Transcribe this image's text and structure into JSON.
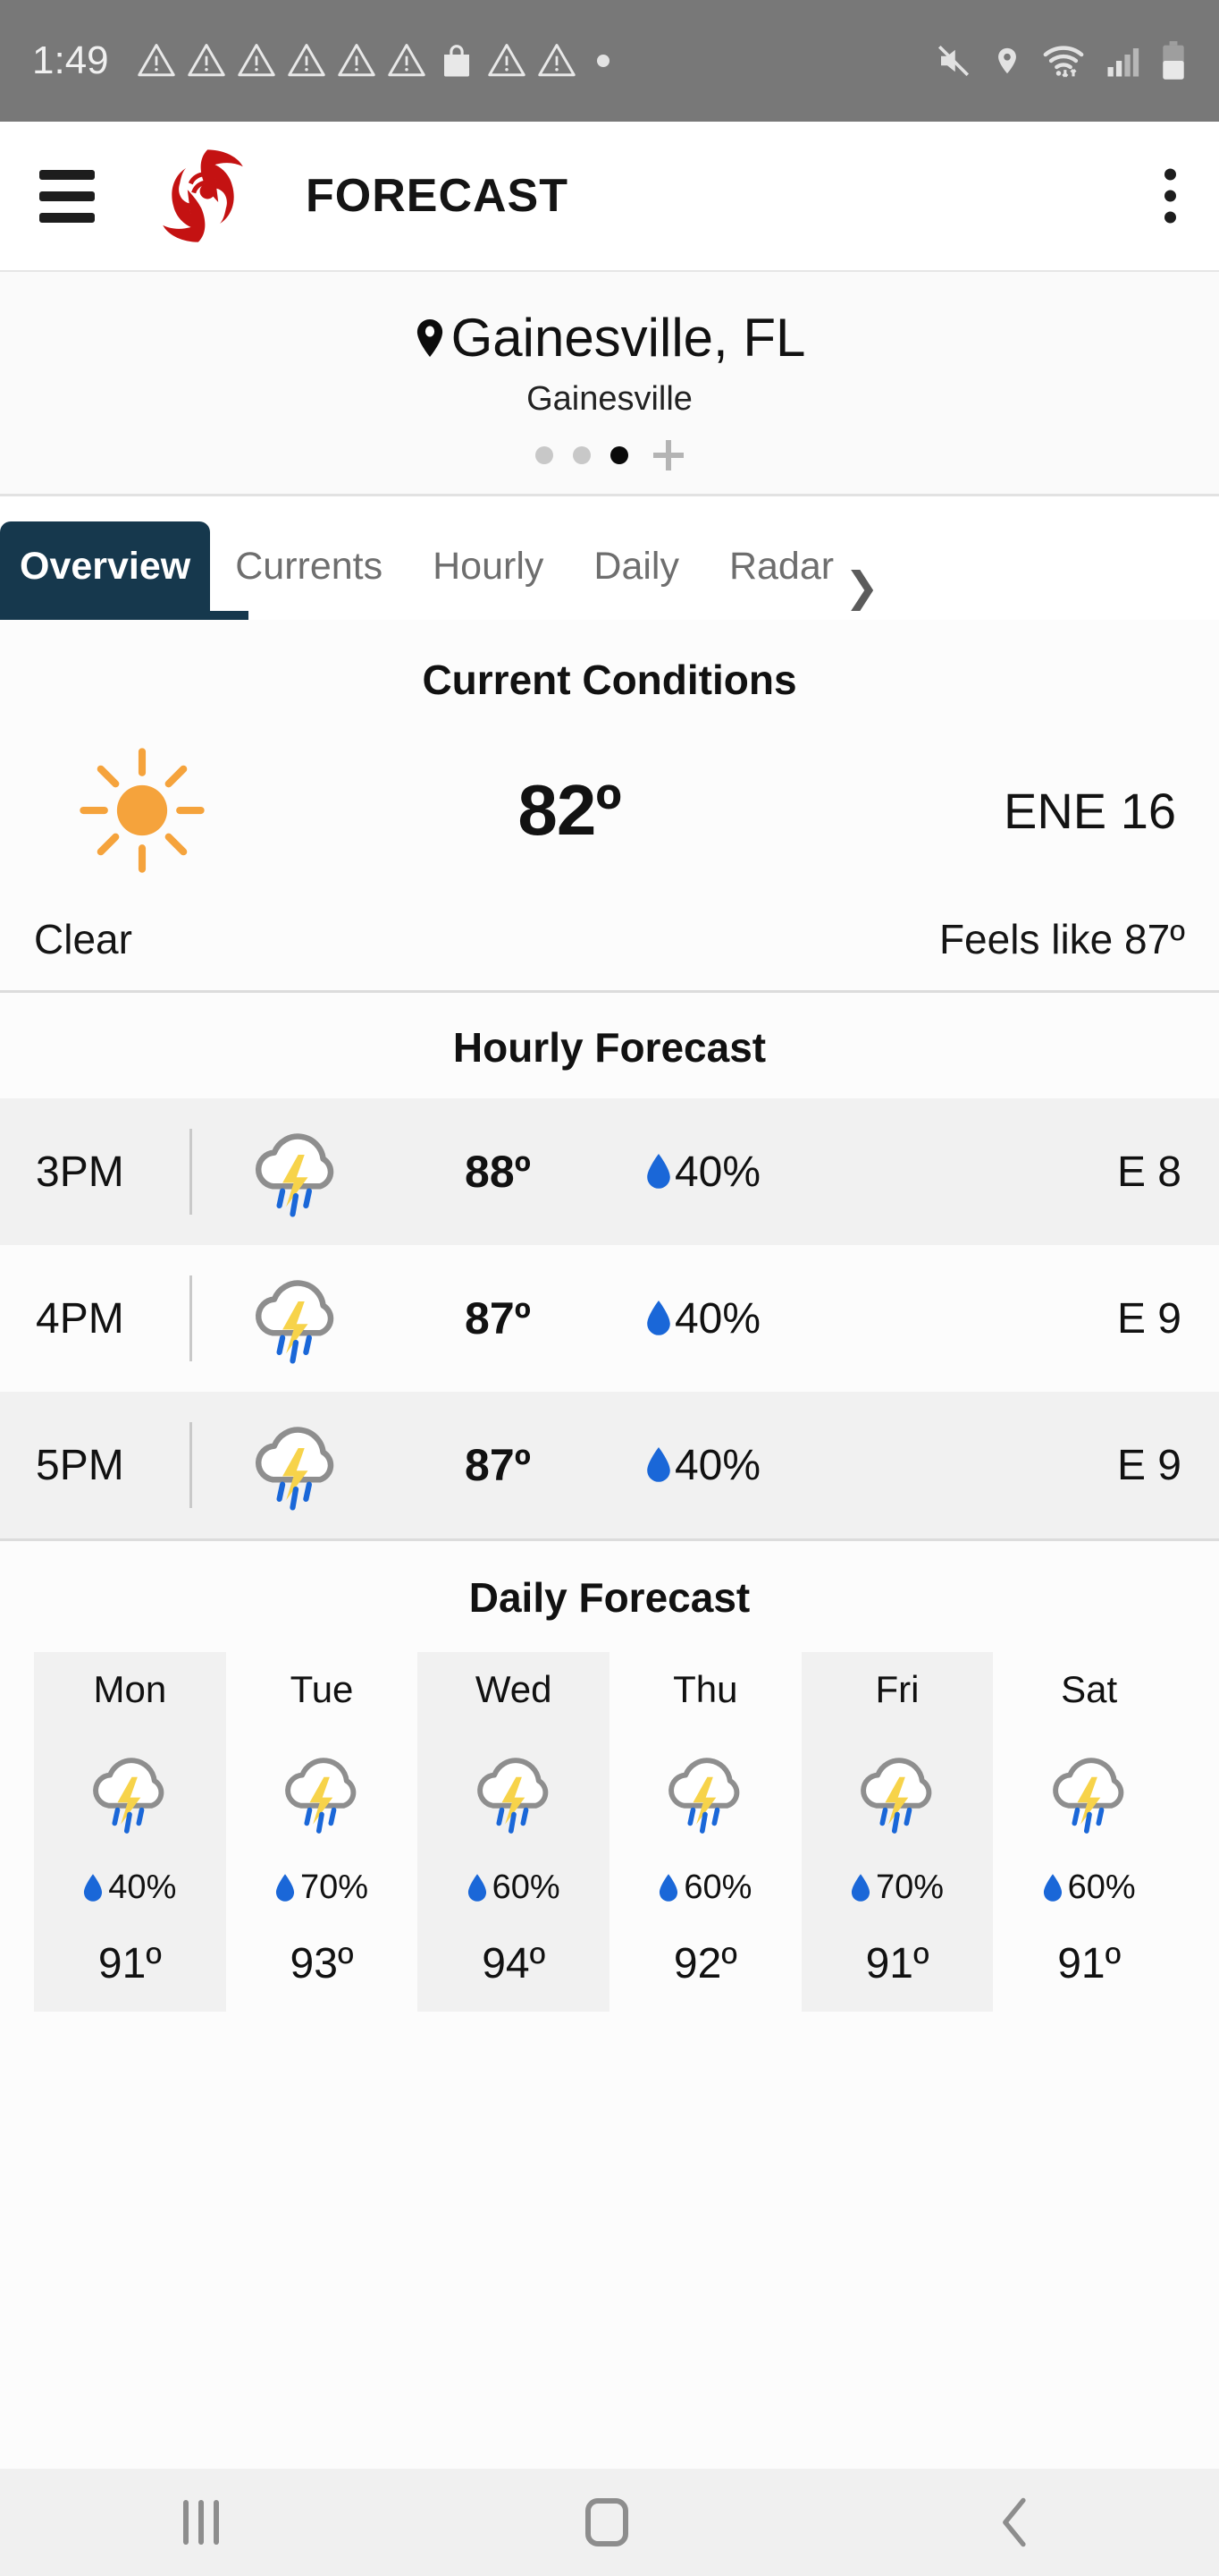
{
  "status_bar": {
    "time": "1:49",
    "left_icons": [
      "warning-icon",
      "warning-icon",
      "warning-icon",
      "warning-icon",
      "warning-icon",
      "warning-icon",
      "shopping-bag-icon",
      "warning-icon",
      "warning-icon",
      "dot-icon"
    ],
    "right_icons": [
      "mute-icon",
      "location-icon",
      "wifi-icon",
      "signal-icon",
      "battery-icon"
    ],
    "bar_color": "#787878"
  },
  "app_bar": {
    "menu_icon": "hamburger-menu-icon",
    "logo_icon": "hurricane-logo-icon",
    "logo_color": "#C41212",
    "title": "FORECAST",
    "overflow_icon": "kebab-menu-icon"
  },
  "location": {
    "pin_icon": "map-pin-icon",
    "name": "Gainesville, FL",
    "sub_name": "Gainesville",
    "pager": {
      "count": 3,
      "active_index": 2,
      "add_label": "+"
    }
  },
  "tabs": {
    "items": [
      {
        "label": "Overview",
        "active": true
      },
      {
        "label": "Currents",
        "active": false
      },
      {
        "label": "Hourly",
        "active": false
      },
      {
        "label": "Daily",
        "active": false
      },
      {
        "label": "Radar",
        "active": false
      }
    ],
    "more_icon": "chevron-right-icon",
    "active_color": "#16384D"
  },
  "current_conditions": {
    "title": "Current Conditions",
    "icon": "sun-clear-icon",
    "icon_color": "#F5A33C",
    "temperature": "82º",
    "wind": "ENE  16",
    "condition": "Clear",
    "feels_like": "Feels like 87º"
  },
  "hourly_forecast": {
    "title": "Hourly Forecast",
    "rows": [
      {
        "time": "3PM",
        "icon": "thunderstorm-icon",
        "temp": "88º",
        "pop": "40%",
        "wind": "E  8"
      },
      {
        "time": "4PM",
        "icon": "thunderstorm-icon",
        "temp": "87º",
        "pop": "40%",
        "wind": "E  9"
      },
      {
        "time": "5PM",
        "icon": "thunderstorm-icon",
        "temp": "87º",
        "pop": "40%",
        "wind": "E  9"
      }
    ]
  },
  "daily_forecast": {
    "title": "Daily Forecast",
    "days": [
      {
        "day": "Mon",
        "icon": "thunderstorm-icon",
        "pop": "40%",
        "temp": "91º"
      },
      {
        "day": "Tue",
        "icon": "thunderstorm-icon",
        "pop": "70%",
        "temp": "93º"
      },
      {
        "day": "Wed",
        "icon": "thunderstorm-icon",
        "pop": "60%",
        "temp": "94º"
      },
      {
        "day": "Thu",
        "icon": "thunderstorm-icon",
        "pop": "60%",
        "temp": "92º"
      },
      {
        "day": "Fri",
        "icon": "thunderstorm-icon",
        "pop": "70%",
        "temp": "91º"
      },
      {
        "day": "Sat",
        "icon": "thunderstorm-icon",
        "pop": "60%",
        "temp": "91º"
      }
    ]
  },
  "nav_bar": {
    "recents_icon": "recents-icon",
    "home_icon": "home-icon",
    "back_icon": "back-icon"
  },
  "colors": {
    "rain_blue": "#1A67D8",
    "lightning_yellow": "#F7D34A",
    "cloud_gray": "#8E8E8E",
    "row_alt": "#F1F1F1"
  }
}
